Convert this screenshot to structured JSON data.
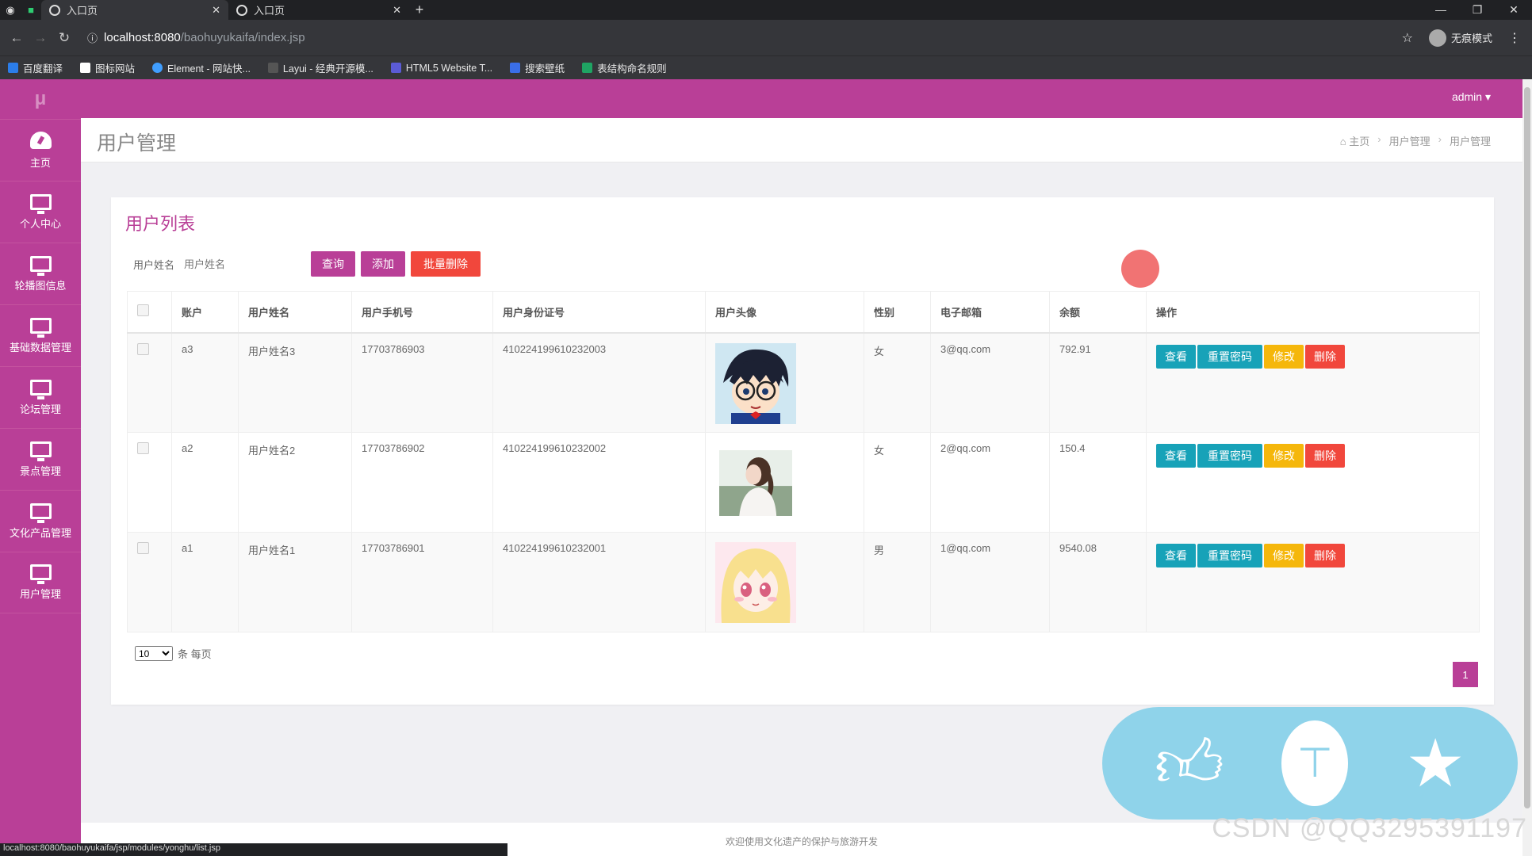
{
  "browser": {
    "tabs": [
      {
        "title": "入口页"
      },
      {
        "title": "入口页"
      }
    ],
    "url_host": "localhost:8080",
    "url_path": "/baohuyukaifa/index.jsp",
    "incognito_label": "无痕模式",
    "bookmarks": [
      "百度翻译",
      "图标网站",
      "Element - 网站快...",
      "Layui - 经典开源模...",
      "HTML5 Website T...",
      "搜索壁纸",
      "表结构命名规则"
    ],
    "status_url": "localhost:8080/baohuyukaifa/jsp/modules/yonghu/list.jsp"
  },
  "header": {
    "logo": "μ",
    "user": "admin ▾"
  },
  "sidebar": {
    "items": [
      {
        "label": "主页",
        "icon": "dashboard-icon"
      },
      {
        "label": "个人中心",
        "icon": "monitor-icon"
      },
      {
        "label": "轮播图信息",
        "icon": "monitor-icon"
      },
      {
        "label": "基础数据管理",
        "icon": "monitor-icon"
      },
      {
        "label": "论坛管理",
        "icon": "monitor-icon"
      },
      {
        "label": "景点管理",
        "icon": "monitor-icon"
      },
      {
        "label": "文化产品管理",
        "icon": "monitor-icon"
      },
      {
        "label": "用户管理",
        "icon": "monitor-icon"
      }
    ]
  },
  "page": {
    "title": "用户管理",
    "breadcrumb": [
      "主页",
      "用户管理",
      "用户管理"
    ]
  },
  "list": {
    "title": "用户列表",
    "filter_label": "用户姓名",
    "filter_placeholder": "用户姓名",
    "btn_query": "查询",
    "btn_add": "添加",
    "btn_batch_delete": "批量删除",
    "columns": [
      "账户",
      "用户姓名",
      "用户手机号",
      "用户身份证号",
      "用户头像",
      "性别",
      "电子邮箱",
      "余额",
      "操作"
    ],
    "rows": [
      {
        "account": "a3",
        "name": "用户姓名3",
        "phone": "17703786903",
        "idcard": "410224199610232003",
        "gender": "女",
        "email": "3@qq.com",
        "balance": "792.91"
      },
      {
        "account": "a2",
        "name": "用户姓名2",
        "phone": "17703786902",
        "idcard": "410224199610232002",
        "gender": "女",
        "email": "2@qq.com",
        "balance": "150.4"
      },
      {
        "account": "a1",
        "name": "用户姓名1",
        "phone": "17703786901",
        "idcard": "410224199610232001",
        "gender": "男",
        "email": "1@qq.com",
        "balance": "9540.08"
      }
    ],
    "op_view": "查看",
    "op_reset": "重置密码",
    "op_edit": "修改",
    "op_delete": "删除",
    "page_size": "10",
    "page_size_suffix": "条 每页",
    "current_page": "1"
  },
  "footer": {
    "text": "欢迎使用文化遗产的保护与旅游开发"
  },
  "watermark": "CSDN @QQ3295391197",
  "colors": {
    "brand": "#b93f97",
    "info": "#17a2b8",
    "warning": "#f5b70b",
    "danger": "#f1473c"
  }
}
